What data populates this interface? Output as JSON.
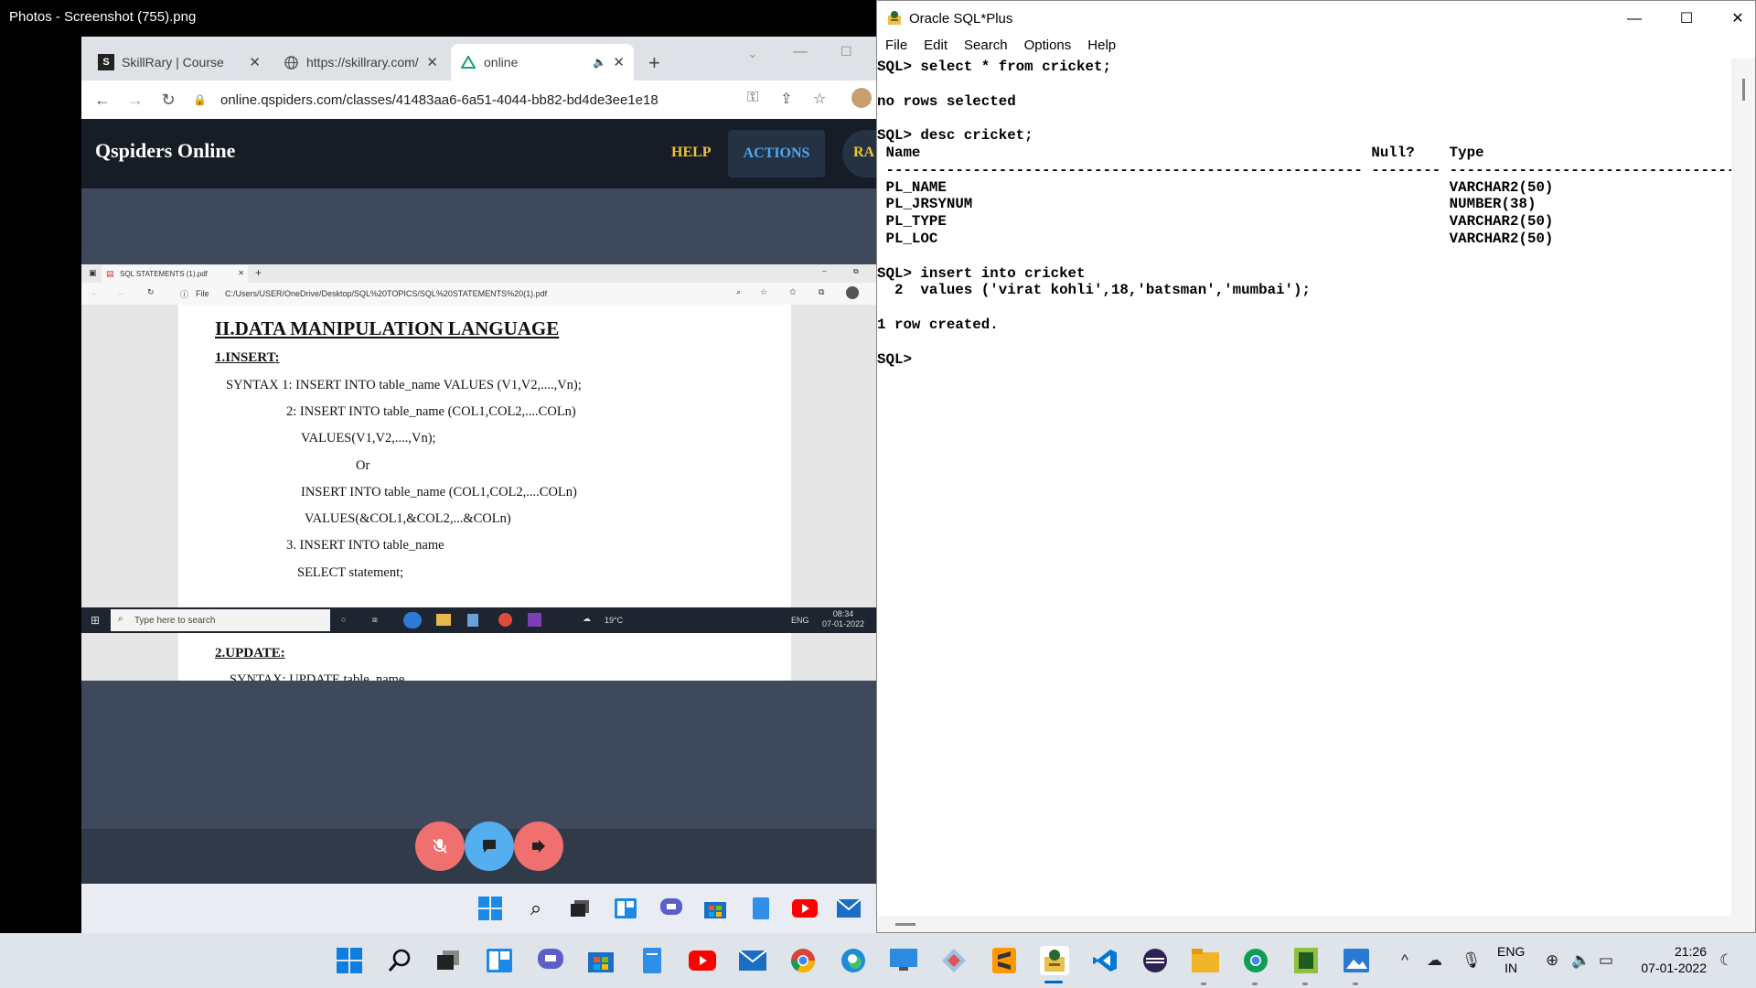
{
  "photos": {
    "title": "Photos - Screenshot (755).png"
  },
  "browser": {
    "tabs": [
      {
        "label": "SkillRary | Course",
        "icon": "skillrary-icon"
      },
      {
        "label": "https://skillrary.com/",
        "icon": "globe-icon"
      },
      {
        "label": "online",
        "icon": "qspiders-icon"
      }
    ],
    "url": "online.qspiders.com/classes/41483aa6-6a51-4044-bb82-bd4de3ee1e18"
  },
  "qspiders": {
    "brand": "Qspiders Online",
    "help": "HELP",
    "actions": "ACTIONS",
    "ra": "RA"
  },
  "pdf_viewer": {
    "tab": "SQL STATEMENTS (1).pdf",
    "file_label": "File",
    "path": "C:/Users/USER/OneDrive/Desktop/SQL%20TOPICS/SQL%20STATEMENTS%20(1).pdf",
    "lines": {
      "heading": "II.DATA MANIPULATION LANGUAGE",
      "insert_heading": "1.INSERT:",
      "syntax1": "SYNTAX 1: INSERT  INTO  table_name  VALUES (V1,V2,....,Vn);",
      "syntax2": "2: INSERT  INTO  table_name (COL1,COL2,....COLn)",
      "values1": "VALUES(V1,V2,....,Vn);",
      "or": "Or",
      "insert_into": "INSERT  INTO  table_name (COL1,COL2,....COLn)",
      "values2": "VALUES(&COL1,&COL2,...&COLn)",
      "syntax3": "3. INSERT INTO table_name",
      "select": "SELECT statement;",
      "update_heading": "2.UPDATE:",
      "update_syntax": "SYNTAX:  UPDATE table_name"
    },
    "taskbar": {
      "search_placeholder": "Type here to search",
      "temperature": "19°C",
      "language": "ENG",
      "time": "08:34",
      "date": "07-01-2022"
    }
  },
  "sqlplus": {
    "title": "Oracle SQL*Plus",
    "menu": [
      "File",
      "Edit",
      "Search",
      "Options",
      "Help"
    ],
    "console_lines": [
      "SQL> select * from cricket;",
      "",
      "no rows selected",
      "",
      "SQL> desc cricket;",
      " Name                                                    Null?    Type",
      " ------------------------------------------------------- -------- ------------------------------------",
      " PL_NAME                                                          VARCHAR2(50)",
      " PL_JRSYNUM                                                       NUMBER(38)",
      " PL_TYPE                                                          VARCHAR2(50)",
      " PL_LOC                                                           VARCHAR2(50)",
      "",
      "SQL> insert into cricket",
      "  2  values ('virat kohli',18,'batsman','mumbai');",
      "",
      "1 row created.",
      "",
      "SQL> "
    ]
  },
  "taskbar": {
    "language": "ENG",
    "region": "IN",
    "time": "21:26",
    "date": "07-01-2022"
  }
}
